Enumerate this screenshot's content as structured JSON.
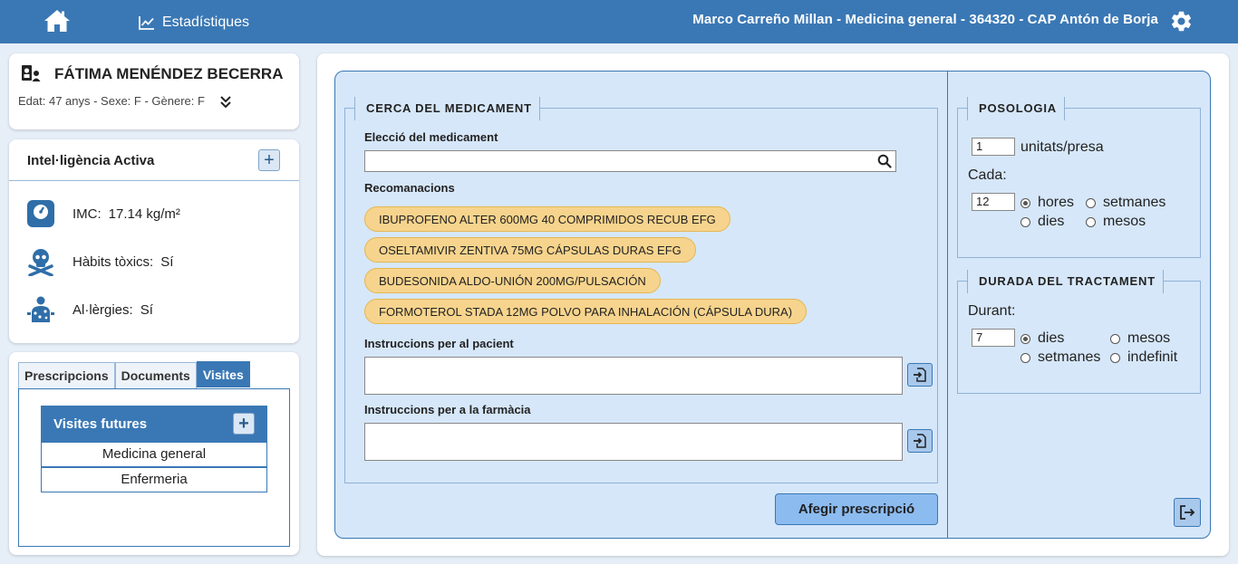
{
  "topbar": {
    "stats_label": "Estadístiques",
    "user_info": "Marco Carreño Millan  -  Medicina general  -  364320  -  CAP Antón de Borja",
    "icons": [
      "home-icon",
      "chart-icon",
      "gear-icon"
    ]
  },
  "patient": {
    "name": "FÁTIMA MENÉNDEZ BECERRA",
    "meta": "Edat: 47 anys - Sexe: F - Gènere: F"
  },
  "ia": {
    "title": "Intel·ligència Activa",
    "imc_label": "IMC:",
    "imc_value": "17.14 kg/m²",
    "toxic_label": "Hàbits tòxics:",
    "toxic_value": "Sí",
    "allergy_label": "Al·lèrgies:",
    "allergy_value": "Sí"
  },
  "tabs": {
    "items": [
      "Prescripcions",
      "Documents",
      "Visites"
    ],
    "active": "Visites",
    "visits_title": "Visites futures",
    "visits": [
      "Medicina general",
      "Enfermeria"
    ]
  },
  "search": {
    "legend": "CERCA DEL MEDICAMENT",
    "choice_label": "Elecció del medicament",
    "choice_value": "",
    "rec_label": "Recomanacions",
    "recommendations": [
      "IBUPROFENO ALTER 600MG 40 COMPRIMIDOS RECUB EFG",
      "OSELTAMIVIR ZENTIVA 75MG CÁPSULAS DURAS EFG",
      "BUDESONIDA ALDO-UNIÓN 200MG/PULSACIÓN",
      "FORMOTEROL STADA 12MG POLVO PARA INHALACIÓN (CÁPSULA DURA)"
    ],
    "patient_instr_label": "Instruccions per al pacient",
    "pharmacy_instr_label": "Instruccions per a la farmàcia",
    "add_button": "Afegir prescripció"
  },
  "posology": {
    "legend": "POSOLOGIA",
    "units_value": "1",
    "units_label": "unitats/presa",
    "every_label": "Cada:",
    "every_value": "12",
    "options": [
      "hores",
      "setmanes",
      "dies",
      "mesos"
    ],
    "selected": "hores"
  },
  "duration": {
    "legend": "DURADA DEL TRACTAMENT",
    "during_label": "Durant:",
    "value": "7",
    "options": [
      "dies",
      "mesos",
      "setmanes",
      "indefinit"
    ],
    "selected": "dies"
  },
  "colors": {
    "primary": "#3a78b5",
    "panel_bg": "#d6e7f9",
    "recommendation": "#f7d48d",
    "add_button": "#8cbbf0"
  }
}
